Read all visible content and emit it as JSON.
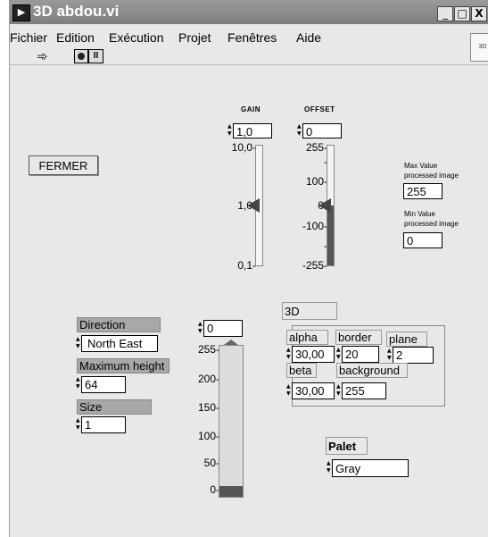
{
  "window": {
    "title": "3D abdou.vi",
    "controls": [
      "_",
      "□",
      "X"
    ],
    "side_tab_label": "3D"
  },
  "menu": [
    {
      "label": "Fichier"
    },
    {
      "label": "Edition"
    },
    {
      "label": "Exécution"
    },
    {
      "label": "Projet"
    },
    {
      "label": "Fenêtres"
    },
    {
      "label": "Aide"
    }
  ],
  "toolbar": {
    "run_icon": "run-arrow-icon",
    "stop_icon": "abort-icon",
    "pause_icon": "pause-icon"
  },
  "fermer": {
    "label": "FERMER"
  },
  "gain": {
    "label": "GAIN",
    "value": "1,0",
    "ticks": [
      "10,0-",
      "1,0-",
      "0,1-"
    ],
    "level": 0.5
  },
  "offset": {
    "label": "OFFSET",
    "value": "0",
    "ticks": [
      "255-",
      "-",
      "100-",
      "0-",
      "-100-",
      "-",
      "-255-"
    ],
    "level": 0.5
  },
  "max_value": {
    "label_line1": "Max Value",
    "label_line2": "processed image",
    "value": "255"
  },
  "min_value": {
    "label_line1": "Min Value",
    "label_line2": "processed image",
    "value": "0"
  },
  "direction": {
    "label": "Direction",
    "value": "North East"
  },
  "max_height": {
    "label": "Maximum height",
    "value": "64"
  },
  "size": {
    "label": "Size",
    "value": "1"
  },
  "meter": {
    "value": "0",
    "ticks": [
      "255-",
      "200-",
      "150-",
      "100-",
      "50-",
      "0-"
    ],
    "level": 0
  },
  "three_d": {
    "title": "3D",
    "alpha": {
      "label": "alpha",
      "value": "30,00"
    },
    "border": {
      "label": "border",
      "value": "20"
    },
    "plane": {
      "label": "plane",
      "value": "2"
    },
    "beta": {
      "label": "beta",
      "value": "30,00"
    },
    "background": {
      "label": "background",
      "value": "255"
    }
  },
  "palet": {
    "label": "Palet",
    "value": "Gray"
  }
}
